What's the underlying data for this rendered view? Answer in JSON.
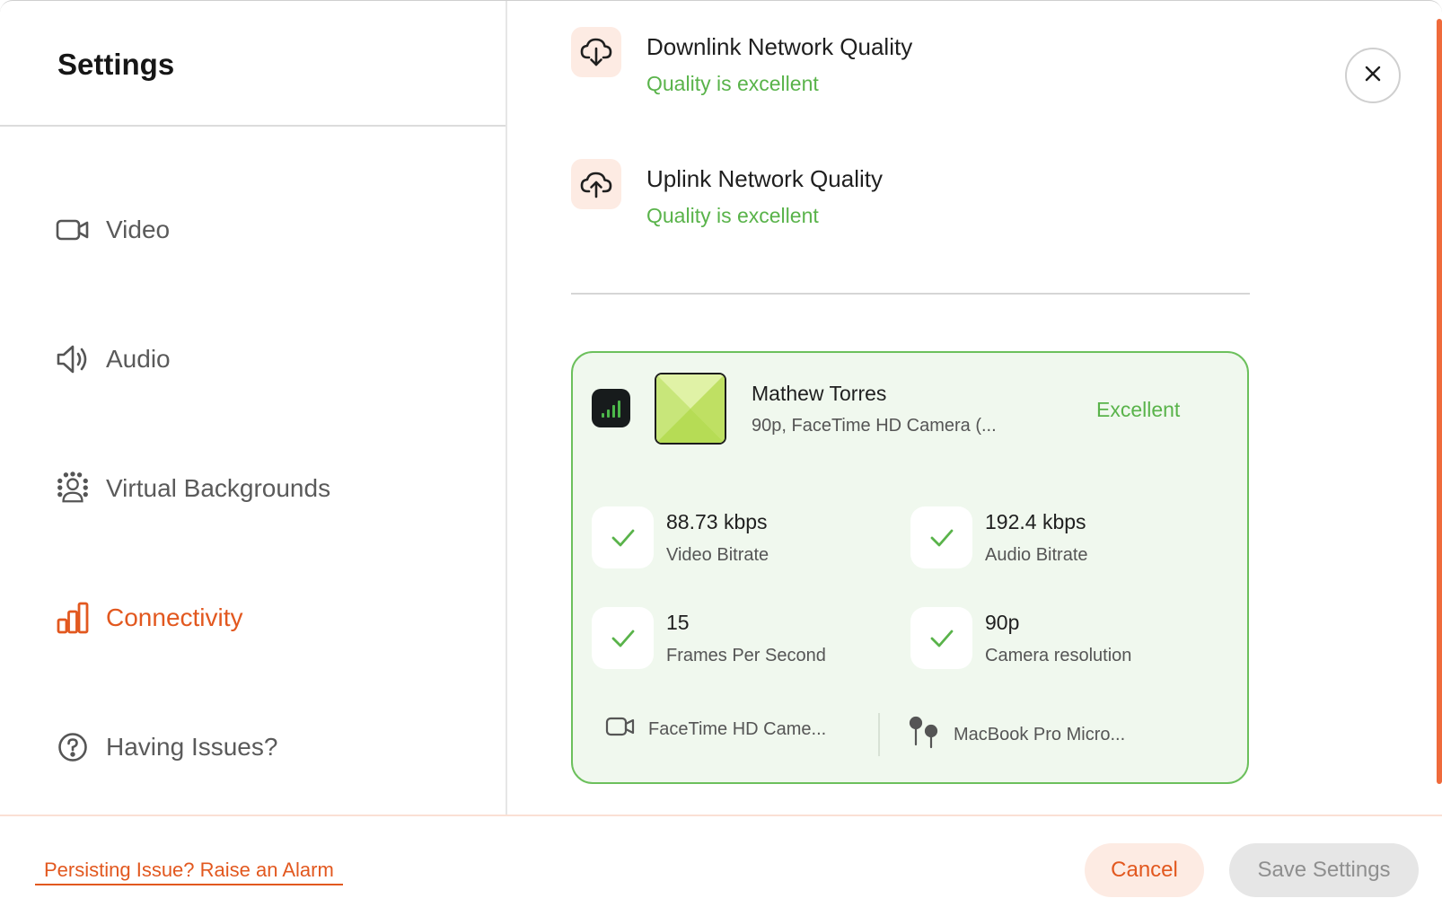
{
  "sidebar": {
    "title": "Settings",
    "items": [
      {
        "label": "Video",
        "icon": "video-camera-icon",
        "active": false
      },
      {
        "label": "Audio",
        "icon": "speaker-icon",
        "active": false
      },
      {
        "label": "Virtual Backgrounds",
        "icon": "virtual-background-icon",
        "active": false
      },
      {
        "label": "Connectivity",
        "icon": "bar-chart-icon",
        "active": true
      },
      {
        "label": "Having Issues?",
        "icon": "question-circle-icon",
        "active": false
      }
    ]
  },
  "network": {
    "downlink": {
      "title": "Downlink Network Quality",
      "status": "Quality is excellent"
    },
    "uplink": {
      "title": "Uplink Network Quality",
      "status": "Quality is excellent"
    }
  },
  "participant": {
    "name": "Mathew Torres",
    "subtitle": "90p, FaceTime HD Camera (...",
    "quality": "Excellent",
    "stats": [
      {
        "value": "88.73 kbps",
        "label": "Video Bitrate"
      },
      {
        "value": "192.4 kbps",
        "label": "Audio Bitrate"
      },
      {
        "value": "15",
        "label": "Frames Per Second"
      },
      {
        "value": "90p",
        "label": "Camera resolution"
      }
    ],
    "devices": {
      "camera": "FaceTime HD Came...",
      "microphone": "MacBook Pro Micro..."
    }
  },
  "footer": {
    "alarm_link": "Persisting Issue? Raise an Alarm",
    "cancel_label": "Cancel",
    "save_label": "Save Settings"
  },
  "colors": {
    "accent": "#e2581f",
    "success": "#59b34a",
    "card_bg": "#f0f8ee",
    "card_border": "#6cc05c"
  }
}
